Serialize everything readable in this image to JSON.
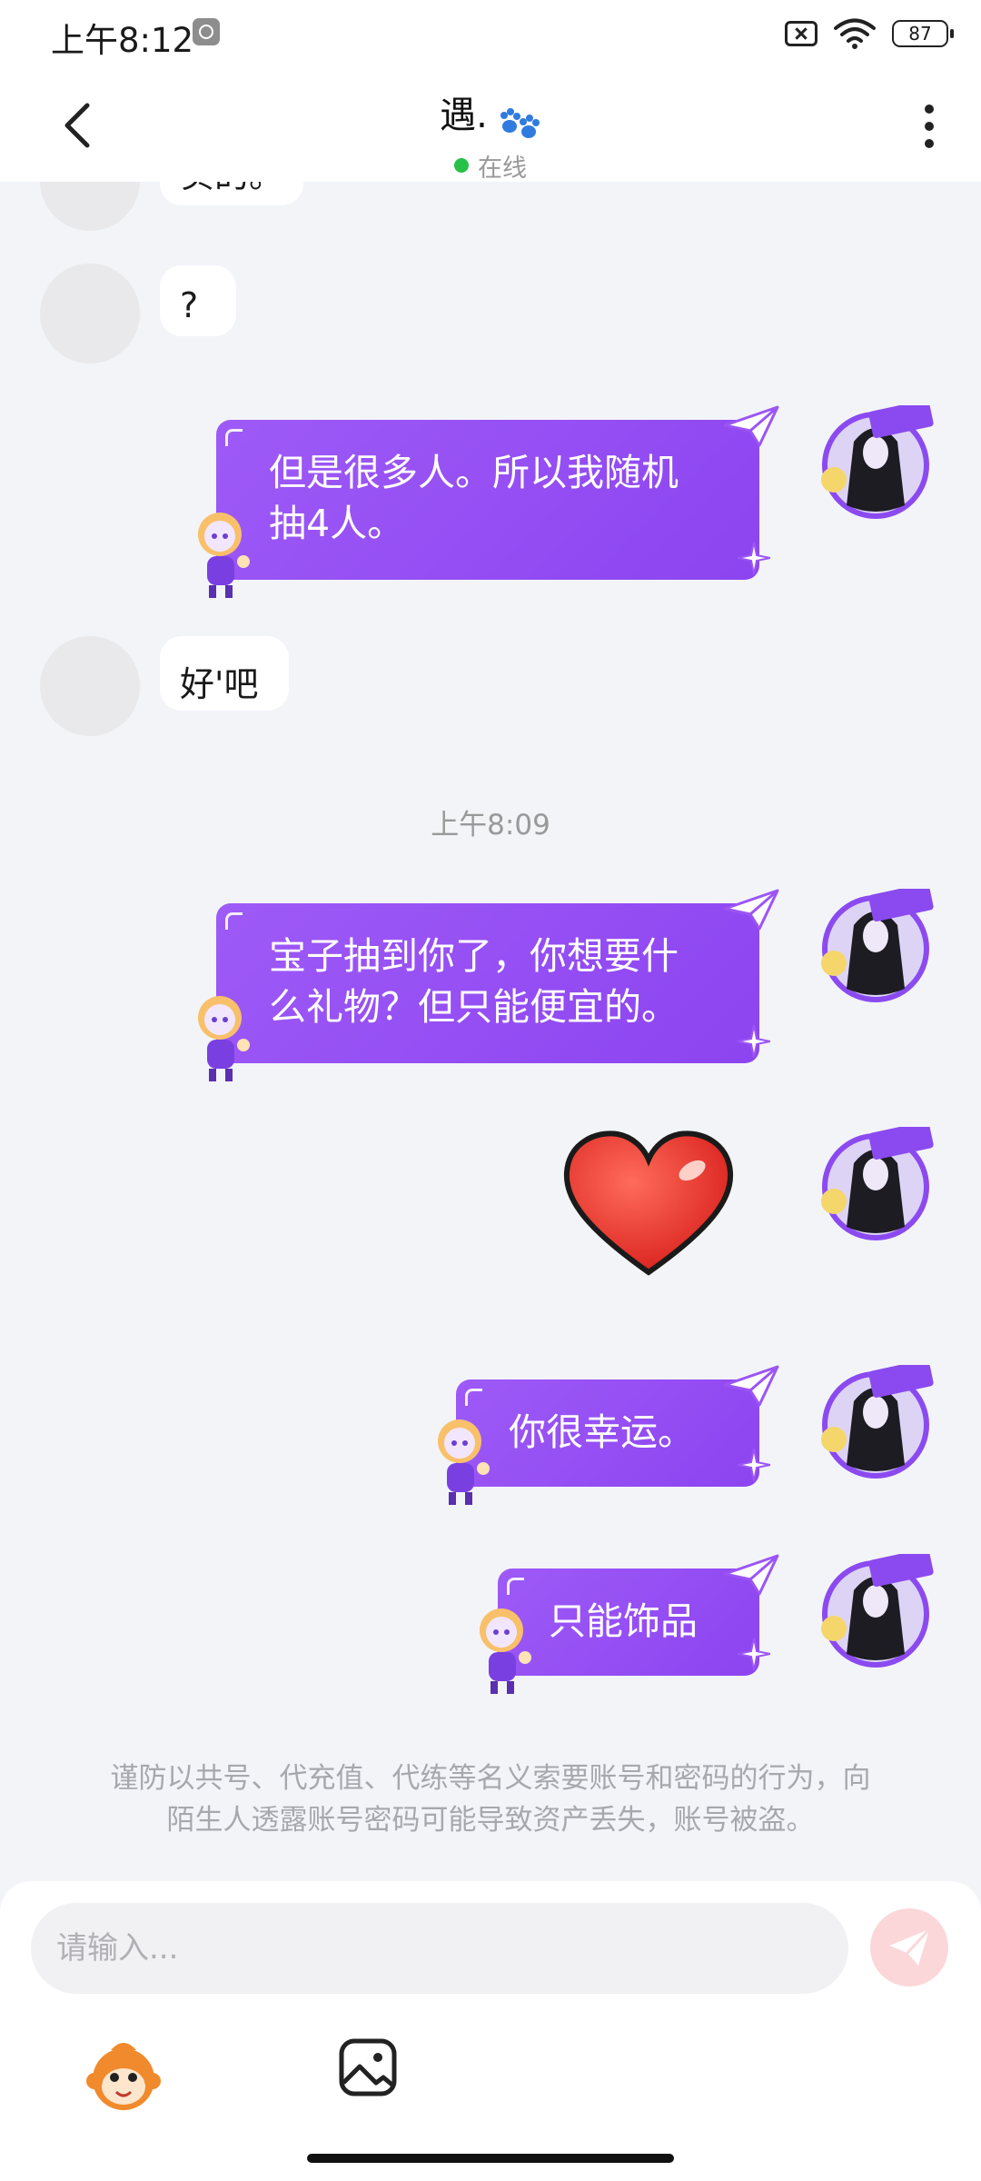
{
  "status_bar": {
    "time": "上午8:12",
    "battery": "87"
  },
  "header": {
    "contact_name": "遇.",
    "presence": "在线"
  },
  "messages": {
    "partial_left": "实的。",
    "left_1": "?",
    "right_1_line1": "但是很多人。所以我随机",
    "right_1_line2": "抽4人。",
    "left_2": "好'吧",
    "timestamp": "上午8:09",
    "right_2_line1": "宝子抽到你了，你想要什",
    "right_2_line2": "么礼物？但只能便宜的。",
    "right_4": "你很幸运。",
    "right_5": "只能饰品"
  },
  "warning": {
    "line1": "谨防以共号、代充值、代练等名义索要账号和密码的行为，向",
    "line2": "陌生人透露账号密码可能导致资产丢失，账号被盗。"
  },
  "input": {
    "placeholder": "请输入..."
  },
  "colors": {
    "bubble_purple": "#9b55f6",
    "online_green": "#27c14a",
    "send_disabled": "#fbd7d9"
  },
  "icons": [
    "back-icon",
    "paw-icon",
    "more-icon",
    "paper-plane-icon",
    "sparkle-icon",
    "heart-sticker",
    "send-icon",
    "emoji-icon",
    "image-icon"
  ]
}
